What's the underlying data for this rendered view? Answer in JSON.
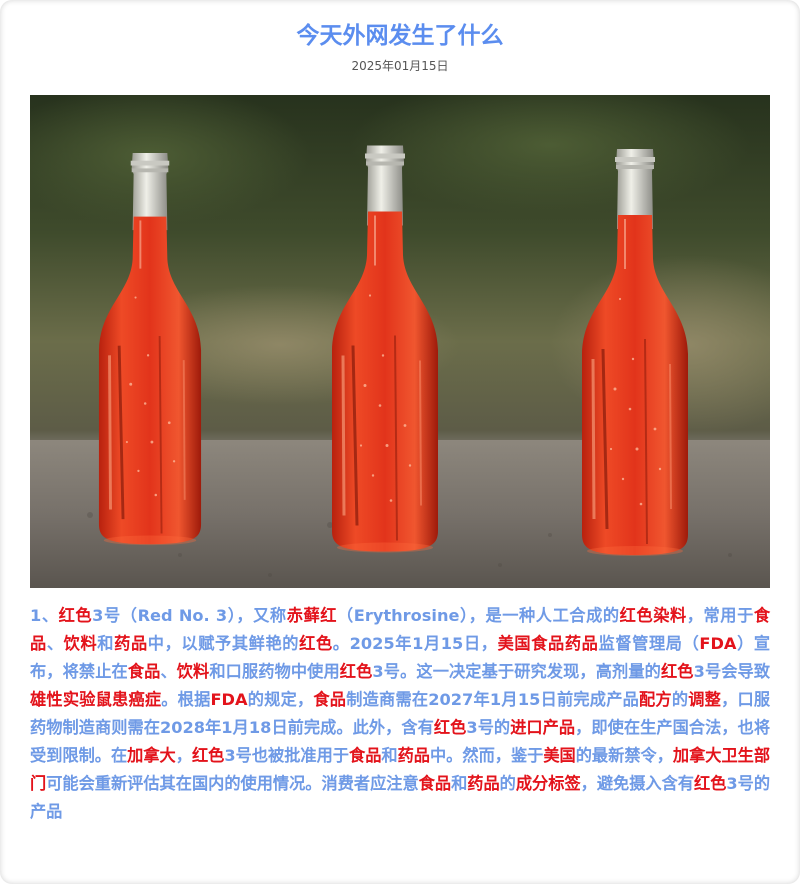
{
  "article": {
    "title": "今天外网发生了什么",
    "date": "2025年01月15日"
  },
  "image": {
    "subject": "three-red-soda-bottles",
    "colors": {
      "background_top": "#2f3a24",
      "background_mid": "#6b6a4a",
      "ledge": "#8a8478",
      "liquid": "#e0341c",
      "liquid_dark": "#a61d0c",
      "glass_top": "#d8d8d0"
    }
  },
  "paragraph": [
    {
      "t": "1、",
      "h": false
    },
    {
      "t": "红色",
      "h": true
    },
    {
      "t": "3号（Red No. 3），又称",
      "h": false
    },
    {
      "t": "赤藓红",
      "h": true
    },
    {
      "t": "（Erythrosine），是一种人工合成的",
      "h": false
    },
    {
      "t": "红色染料",
      "h": true
    },
    {
      "t": "，常用于",
      "h": false
    },
    {
      "t": "食品",
      "h": true
    },
    {
      "t": "、",
      "h": false
    },
    {
      "t": "饮料",
      "h": true
    },
    {
      "t": "和",
      "h": false
    },
    {
      "t": "药品",
      "h": true
    },
    {
      "t": "中，以赋予其鲜艳的",
      "h": false
    },
    {
      "t": "红色",
      "h": true
    },
    {
      "t": "。2025年1月15日，",
      "h": false
    },
    {
      "t": "美国食品药品",
      "h": true
    },
    {
      "t": "监督管理局（",
      "h": false
    },
    {
      "t": "FDA",
      "h": true
    },
    {
      "t": "）宣布，将禁止在",
      "h": false
    },
    {
      "t": "食品",
      "h": true
    },
    {
      "t": "、",
      "h": false
    },
    {
      "t": "饮料",
      "h": true
    },
    {
      "t": "和口服药物中使用",
      "h": false
    },
    {
      "t": "红色",
      "h": true
    },
    {
      "t": "3号。这一决定基于研究发现，高剂量的",
      "h": false
    },
    {
      "t": "红色",
      "h": true
    },
    {
      "t": "3号会导致",
      "h": false
    },
    {
      "t": "雄性实验鼠患癌症",
      "h": true
    },
    {
      "t": "。根据",
      "h": false
    },
    {
      "t": "FDA",
      "h": true
    },
    {
      "t": "的规定，",
      "h": false
    },
    {
      "t": "食品",
      "h": true
    },
    {
      "t": "制造商需在2027年1月15日前完成产品",
      "h": false
    },
    {
      "t": "配方",
      "h": true
    },
    {
      "t": "的",
      "h": false
    },
    {
      "t": "调整",
      "h": true
    },
    {
      "t": "，口服药物制造商则需在2028年1月18日前完成。此外，含有",
      "h": false
    },
    {
      "t": "红色",
      "h": true
    },
    {
      "t": "3号的",
      "h": false
    },
    {
      "t": "进口产品",
      "h": true
    },
    {
      "t": "，即使在生产国合法，也将受到限制。在",
      "h": false
    },
    {
      "t": "加拿大",
      "h": true
    },
    {
      "t": "，",
      "h": false
    },
    {
      "t": "红色",
      "h": true
    },
    {
      "t": "3号也被批准用于",
      "h": false
    },
    {
      "t": "食品",
      "h": true
    },
    {
      "t": "和",
      "h": false
    },
    {
      "t": "药品",
      "h": true
    },
    {
      "t": "中。然而，鉴于",
      "h": false
    },
    {
      "t": "美国",
      "h": true
    },
    {
      "t": "的最新禁令，",
      "h": false
    },
    {
      "t": "加拿大卫生部门",
      "h": true
    },
    {
      "t": "可能会重新评估其在国内的使用情况。消费者应注意",
      "h": false
    },
    {
      "t": "食品",
      "h": true
    },
    {
      "t": "和",
      "h": false
    },
    {
      "t": "药品",
      "h": true
    },
    {
      "t": "的",
      "h": false
    },
    {
      "t": "成分标签",
      "h": true
    },
    {
      "t": "，避免摄入含有",
      "h": false
    },
    {
      "t": "红色",
      "h": true
    },
    {
      "t": "3号的产品",
      "h": false
    }
  ]
}
